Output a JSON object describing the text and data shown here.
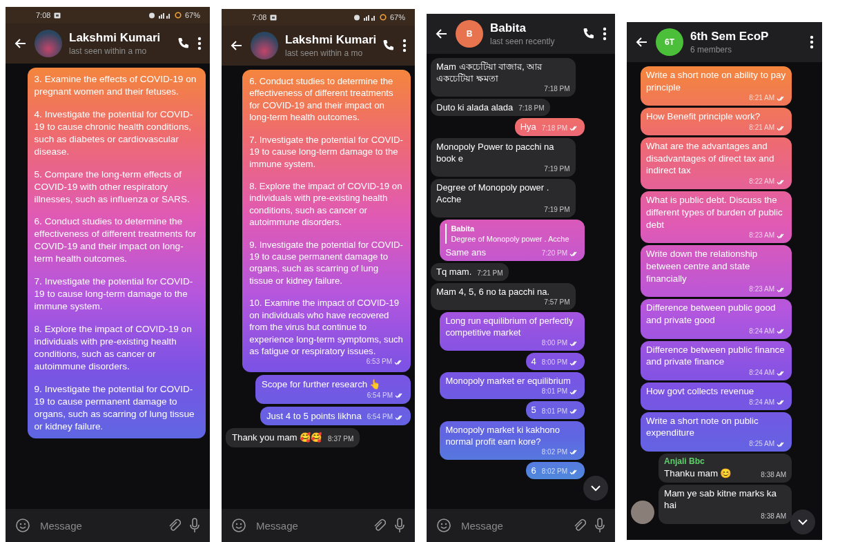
{
  "screens": [
    {
      "status_bar": {
        "time": "7:08",
        "battery": "67%"
      },
      "header": {
        "title": "Lakshmi Kumari",
        "subtitle": "last seen within a mo",
        "avatar": {
          "kind": "photo"
        },
        "call_button": true
      },
      "messages": [
        {
          "kind": "out",
          "paragraphs": [
            "3. Examine the effects of COVID-19 on pregnant women and their fetuses.",
            "4. Investigate the potential for COVID-19 to cause chronic health conditions, such as diabetes or cardiovascular disease.",
            "5. Compare the long-term effects of COVID-19 with other respiratory illnesses, such as influenza or SARS.",
            "6. Conduct studies to determine the effectiveness of different treatments for COVID-19 and their impact on long-term health outcomes.",
            "7. Investigate the potential for COVID-19 to cause long-term damage to the immune system.",
            "8. Explore the impact of COVID-19 on individuals with pre-existing health conditions, such as cancer or autoimmune disorders.",
            "9. Investigate the potential for COVID-19 to cause permanent damage to organs, such as scarring of lung tissue or kidney failure."
          ]
        }
      ],
      "composer": {
        "placeholder": "Message"
      },
      "scroll_down_button": false
    },
    {
      "status_bar": {
        "time": "7:08",
        "battery": "67%"
      },
      "header": {
        "title": "Lakshmi Kumari",
        "subtitle": "last seen within a mo",
        "avatar": {
          "kind": "photo"
        },
        "call_button": true
      },
      "messages": [
        {
          "kind": "out",
          "paragraphs": [
            "6. Conduct studies to determine the effectiveness of different treatments for COVID-19 and their impact on long-term health outcomes.",
            "7. Investigate the potential for COVID-19 to cause long-term damage to the immune system.",
            "8. Explore the impact of COVID-19 on individuals with pre-existing health conditions, such as cancer or autoimmune disorders.",
            "9. Investigate the potential for COVID-19 to cause permanent damage to organs, such as scarring of lung tissue or kidney failure.",
            "10. Examine the impact of COVID-19 on individuals who have recovered from the virus but continue to experience long-term symptoms, such as fatigue or respiratory issues."
          ],
          "time": "6:53 PM",
          "read": true
        },
        {
          "kind": "out",
          "text": "Scope for further research 👆",
          "time": "6:54 PM",
          "read": true
        },
        {
          "kind": "out",
          "text": "Just 4 to 5 points likhna",
          "time": "6:54 PM",
          "read": true
        },
        {
          "kind": "in",
          "text": "Thank you mam 🥰🥰",
          "time": "8:37 PM"
        }
      ],
      "composer": {
        "placeholder": "Message"
      },
      "scroll_down_button": false
    },
    {
      "header": {
        "title": "Babita",
        "subtitle": "last seen recently",
        "avatar": {
          "kind": "letters",
          "text": "B",
          "color": "#e8734f"
        },
        "call_button": true
      },
      "messages": [
        {
          "kind": "in",
          "text": "Mam একচেটিয়া বাজার, আর একচেটিয়া ক্ষমতা",
          "time": "7:18 PM"
        },
        {
          "kind": "in",
          "text": "Duto ki alada alada",
          "time": "7:18 PM"
        },
        {
          "kind": "out",
          "text": "Hya",
          "time": "7:18 PM",
          "read": true
        },
        {
          "kind": "in",
          "text": "Monopoly Power to pacchi na book e",
          "time": "7:19 PM"
        },
        {
          "kind": "in",
          "text": "Degree of Monopoly power . Acche",
          "time": "7:19 PM"
        },
        {
          "kind": "out",
          "quote": {
            "name": "Babita",
            "text": "Degree of Monopoly power . Acche"
          },
          "text": "Same ans",
          "time": "7:20 PM",
          "read": true
        },
        {
          "kind": "in",
          "text": "Tq mam.",
          "time": "7:21 PM"
        },
        {
          "kind": "in",
          "text": "Mam 4, 5, 6 no ta pacchi na.",
          "time": "7:57 PM"
        },
        {
          "kind": "out",
          "text": "Long run equilibrium of perfectly competitive market",
          "time": "8:00 PM",
          "read": true
        },
        {
          "kind": "out",
          "text": "4",
          "time": "8:00 PM",
          "read": true
        },
        {
          "kind": "out",
          "text": "Monopoly market er equilibrium",
          "time": "8:01 PM",
          "read": true
        },
        {
          "kind": "out",
          "text": "5",
          "time": "8:01 PM",
          "read": true
        },
        {
          "kind": "out",
          "text": "Monopoly market ki kakhono normal profit earn kore?",
          "time": "8:02 PM",
          "read": true
        },
        {
          "kind": "out",
          "text": "6",
          "time": "8:02 PM",
          "read": true
        }
      ],
      "composer": {
        "placeholder": "Message"
      },
      "scroll_down_button": true
    },
    {
      "header": {
        "title": "6th Sem EcoP",
        "subtitle": "6 members",
        "avatar": {
          "kind": "letters",
          "text": "6T",
          "color": "#4cbf3a"
        },
        "call_button": false
      },
      "messages": [
        {
          "kind": "out",
          "text": "Write a short note on ability to pay principle",
          "time": "8:21 AM",
          "read": true
        },
        {
          "kind": "out",
          "text": "How Benefit principle work?",
          "time": "8:21 AM",
          "read": true
        },
        {
          "kind": "out",
          "text": "What are the advantages and disadvantages of direct tax and indirect tax",
          "time": "8:22 AM",
          "read": true
        },
        {
          "kind": "out",
          "text": "What is public debt. Discuss the different types of burden of public debt",
          "time": "8:23 AM",
          "read": true
        },
        {
          "kind": "out",
          "text": "Write down the relationship between centre and state financially",
          "time": "8:23 AM",
          "read": true
        },
        {
          "kind": "out",
          "text": "Difference between public good and private good",
          "time": "8:24 AM",
          "read": true
        },
        {
          "kind": "out",
          "text": "Difference between public finance and private finance",
          "time": "8:24 AM",
          "read": true
        },
        {
          "kind": "out",
          "text": "How govt collects revenue",
          "time": "8:24 AM",
          "read": true
        },
        {
          "kind": "out",
          "text": "Write a short note on public expenditure",
          "time": "8:25 AM",
          "read": true
        },
        {
          "kind": "in",
          "sender": "Anjali Bbc",
          "text": "Thanku mam 😊",
          "time": "8:38 AM",
          "show_avatar": false
        },
        {
          "kind": "in",
          "text": "Mam ye sab kitne marks ka hai",
          "time": "8:38 AM",
          "show_avatar": true
        }
      ],
      "scroll_down_button": true
    }
  ]
}
